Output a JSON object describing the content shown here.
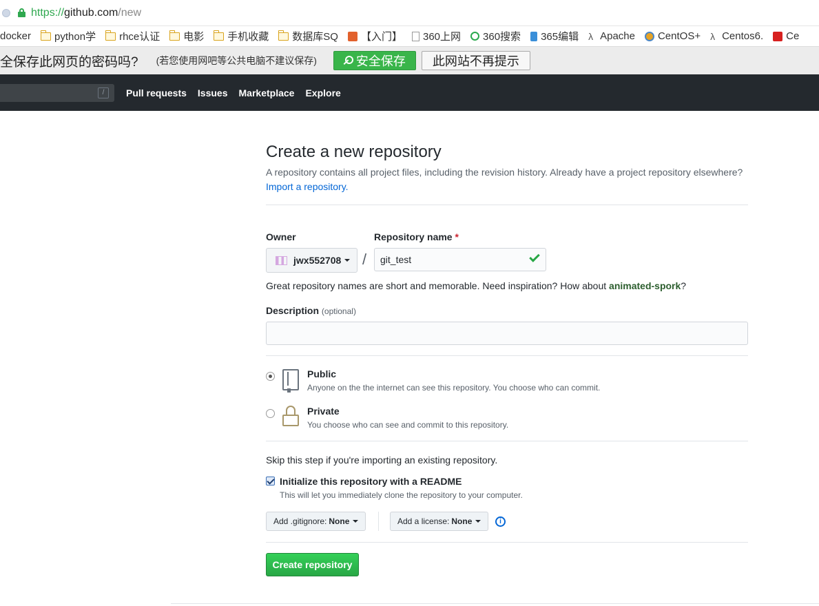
{
  "browser": {
    "url_scheme": "https://",
    "url_host": "github.com",
    "url_path": "/new"
  },
  "bookmarks": [
    {
      "label": "docker",
      "icon": "none"
    },
    {
      "label": "python学",
      "icon": "folder-icon"
    },
    {
      "label": "rhce认证",
      "icon": "folder-icon"
    },
    {
      "label": "电影",
      "icon": "folder-icon"
    },
    {
      "label": "手机收藏",
      "icon": "folder-icon"
    },
    {
      "label": "数据库SQ",
      "icon": "folder-icon"
    },
    {
      "label": "【入门】",
      "icon": "orange-icon"
    },
    {
      "label": "360上网",
      "icon": "page-icon"
    },
    {
      "label": "360搜索",
      "icon": "search360-icon"
    },
    {
      "label": "365编辑",
      "icon": "blue-icon"
    },
    {
      "label": "Apache",
      "icon": "apache-icon"
    },
    {
      "label": "CentOS+",
      "icon": "centos-icon"
    },
    {
      "label": "Centos6.",
      "icon": "apache-icon"
    },
    {
      "label": "Ce",
      "icon": "red-icon"
    }
  ],
  "password_bar": {
    "question": "全保存此网页的密码吗?",
    "note": "(若您使用网吧等公共电脑不建议保存)",
    "save_label": "安全保存",
    "never_label": "此网站不再提示"
  },
  "gh_header": {
    "slash_key": "/",
    "nav": [
      "Pull requests",
      "Issues",
      "Marketplace",
      "Explore"
    ]
  },
  "form": {
    "title": "Create a new repository",
    "subtitle": "A repository contains all project files, including the revision history. Already have a project repository elsewhere?",
    "import_link": "Import a repository.",
    "owner_label": "Owner",
    "owner_value": "jwx552708",
    "repo_name_label": "Repository name",
    "required_mark": "*",
    "repo_name_value": "git_test",
    "separator": "/",
    "hint_prefix": "Great repository names are short and memorable. Need inspiration? How about ",
    "hint_suggestion": "animated-spork",
    "hint_suffix": "?",
    "description_label": "Description",
    "description_optional": "(optional)",
    "description_value": "",
    "public_title": "Public",
    "public_desc": "Anyone on the the internet can see this repository. You choose who can commit.",
    "private_title": "Private",
    "private_desc": "You choose who can see and commit to this repository.",
    "visibility_selected": "Public",
    "skip_text": "Skip this step if you're importing an existing repository.",
    "init_label": "Initialize this repository with a README",
    "init_desc": "This will let you immediately clone the repository to your computer.",
    "init_checked": true,
    "gitignore_label": "Add .gitignore:",
    "gitignore_value": "None",
    "license_label": "Add a license:",
    "license_value": "None",
    "info_glyph": "i",
    "create_label": "Create repository"
  },
  "colors": {
    "header_bg": "#24292e",
    "primary_green": "#28a745",
    "link_blue": "#0366d6"
  }
}
